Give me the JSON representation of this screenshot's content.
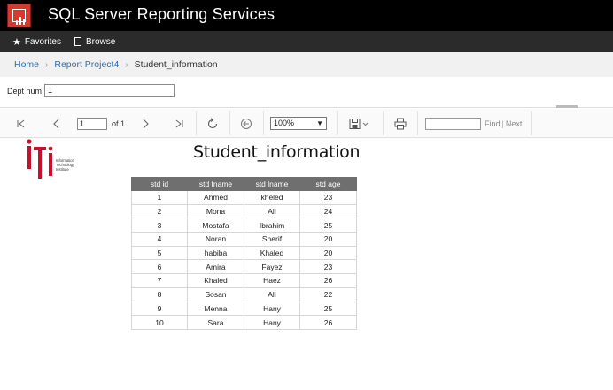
{
  "app": {
    "title": "SQL Server Reporting Services"
  },
  "nav": {
    "favorites": "Favorites",
    "browse": "Browse"
  },
  "breadcrumb": [
    "Home",
    "Report Project4",
    "Student_information"
  ],
  "params": {
    "label": "Dept num",
    "value": "1"
  },
  "toolbar": {
    "page_value": "1",
    "of_label": "of 1",
    "zoom": "100%",
    "find_label": "Find",
    "next_label": "Next"
  },
  "icons": {
    "first": "first-page-icon",
    "prev": "previous-page-icon",
    "next": "next-page-icon",
    "last": "last-page-icon",
    "refresh": "refresh-icon",
    "back": "back-icon",
    "export": "save-icon",
    "print": "print-icon"
  },
  "colors": {
    "accent": "#d63a2f",
    "link": "#2a6ebb",
    "header": "#6f6f6f"
  },
  "report": {
    "title": "Student_information",
    "logo_text": [
      "Information",
      "Technology",
      "Institute"
    ],
    "columns": [
      "std id",
      "std fname",
      "std lname",
      "std age"
    ],
    "rows": [
      [
        "1",
        "Ahmed",
        "kheled",
        "23"
      ],
      [
        "2",
        "Mona",
        "Ali",
        "24"
      ],
      [
        "3",
        "Mostafa",
        "Ibrahim",
        "25"
      ],
      [
        "4",
        "Noran",
        "Sherif",
        "20"
      ],
      [
        "5",
        "habiba",
        "Khaled",
        "20"
      ],
      [
        "6",
        "Amira",
        "Fayez",
        "23"
      ],
      [
        "7",
        "Khaled",
        "Haez",
        "26"
      ],
      [
        "8",
        "Sosan",
        "Ali",
        "22"
      ],
      [
        "9",
        "Menna",
        "Hany",
        "25"
      ],
      [
        "10",
        "Sara",
        "Hany",
        "26"
      ]
    ]
  }
}
